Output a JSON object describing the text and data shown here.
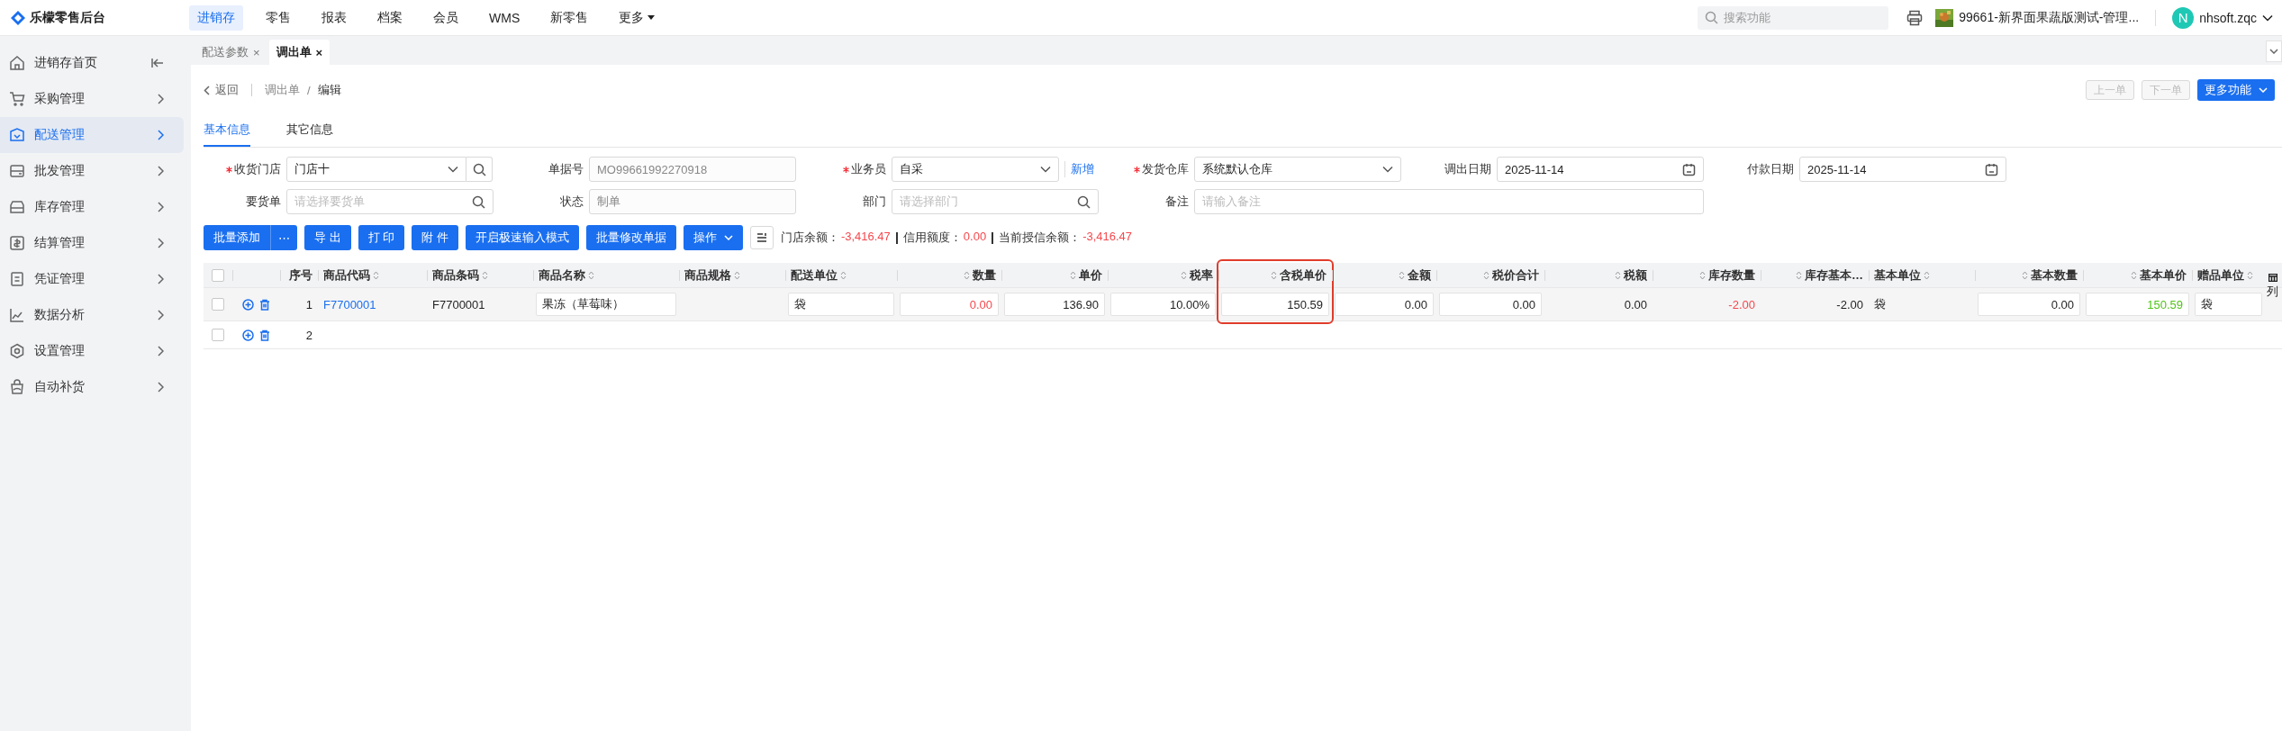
{
  "app": {
    "title": "乐檬零售后台"
  },
  "top_nav": [
    {
      "label": "进销存",
      "selected": true,
      "kind": "link"
    },
    {
      "label": "零售",
      "selected": false,
      "kind": "link"
    },
    {
      "label": "报表",
      "selected": false,
      "kind": "link"
    },
    {
      "label": "档案",
      "selected": false,
      "kind": "link"
    },
    {
      "label": "会员",
      "selected": false,
      "kind": "link"
    },
    {
      "label": "WMS",
      "selected": false,
      "kind": "link"
    },
    {
      "label": "新零售",
      "selected": false,
      "kind": "link"
    },
    {
      "label": "更多",
      "selected": false,
      "kind": "dropdown"
    }
  ],
  "search": {
    "placeholder": "搜索功能"
  },
  "store": {
    "name": "99661-新界面果蔬版测试-管理..."
  },
  "user": {
    "avatar": "N",
    "name": "nhsoft.zqc"
  },
  "sidebar": {
    "items": [
      {
        "label": "进销存首页",
        "selected": false
      },
      {
        "label": "采购管理",
        "selected": false
      },
      {
        "label": "配送管理",
        "selected": true
      },
      {
        "label": "批发管理",
        "selected": false
      },
      {
        "label": "库存管理",
        "selected": false
      },
      {
        "label": "结算管理",
        "selected": false
      },
      {
        "label": "凭证管理",
        "selected": false
      },
      {
        "label": "数据分析",
        "selected": false
      },
      {
        "label": "设置管理",
        "selected": false
      },
      {
        "label": "自动补货",
        "selected": false
      }
    ]
  },
  "tabs": [
    {
      "label": "配送参数",
      "close": "×",
      "selected": false
    },
    {
      "label": "调出单",
      "close": "×",
      "selected": true
    }
  ],
  "breadcrumb": {
    "back": "返回",
    "path": [
      "调出单",
      "编辑"
    ],
    "separator": "/"
  },
  "nav_buttons": [
    {
      "label": "上一单",
      "disabled": true
    },
    {
      "label": "下一单",
      "disabled": true
    }
  ],
  "more_button": {
    "label": "更多功能"
  },
  "section_tabs": [
    {
      "label": "基本信息",
      "selected": true
    },
    {
      "label": "其它信息",
      "selected": false
    }
  ],
  "form": {
    "fields": [
      {
        "label": "收货门店",
        "required": true,
        "disabled": false,
        "kind": "select-search",
        "value": "门店十"
      },
      {
        "label": "单据号",
        "required": false,
        "disabled": true,
        "kind": "text",
        "value": "MO99661992270918"
      },
      {
        "label": "业务员",
        "required": true,
        "disabled": false,
        "kind": "select",
        "value": "自采",
        "link": "新增"
      },
      {
        "label": "发货仓库",
        "required": true,
        "disabled": false,
        "kind": "select",
        "value": "系统默认仓库"
      },
      {
        "label": "调出日期",
        "required": false,
        "disabled": false,
        "kind": "date",
        "value": "2025-11-14"
      },
      {
        "label": "付款日期",
        "required": false,
        "disabled": false,
        "kind": "date",
        "value": "2025-11-14"
      },
      {
        "label": "要货单",
        "required": false,
        "disabled": false,
        "kind": "search",
        "placeholder": "请选择要货单"
      },
      {
        "label": "状态",
        "required": false,
        "disabled": true,
        "kind": "text",
        "value": "制单"
      },
      {
        "label": "部门",
        "required": false,
        "disabled": false,
        "kind": "search",
        "placeholder": "请选择部门"
      },
      {
        "label": "备注",
        "required": false,
        "disabled": false,
        "kind": "wide",
        "placeholder": "请输入备注"
      }
    ]
  },
  "actions": [
    {
      "label": "批量添加",
      "kind": "split",
      "more": "⋯"
    },
    {
      "label": "导 出",
      "kind": "plain"
    },
    {
      "label": "打 印",
      "kind": "plain"
    },
    {
      "label": "附 件",
      "kind": "plain"
    },
    {
      "label": "开启极速输入模式",
      "kind": "plain"
    },
    {
      "label": "批量修改单据",
      "kind": "plain"
    },
    {
      "label": "操作",
      "kind": "dropdown"
    }
  ],
  "balances": [
    {
      "label": "门店余额：",
      "value": "-3,416.47"
    },
    {
      "label": "信用额度：",
      "value": "0.00"
    },
    {
      "label": "当前授信余额：",
      "value": "-3,416.47"
    }
  ],
  "table": {
    "all_checked": false,
    "columns": [
      {
        "label": "序号",
        "sortable": false,
        "kind": "number",
        "highlighted": false
      },
      {
        "label": "商品代码",
        "sortable": true,
        "kind": "text",
        "highlighted": false
      },
      {
        "label": "商品条码",
        "sortable": true,
        "kind": "text",
        "highlighted": false
      },
      {
        "label": "商品名称",
        "sortable": true,
        "kind": "text",
        "highlighted": false
      },
      {
        "label": "商品规格",
        "sortable": true,
        "kind": "text",
        "highlighted": false
      },
      {
        "label": "配送单位",
        "sortable": true,
        "kind": "text",
        "highlighted": false
      },
      {
        "label": "数量",
        "sortable": true,
        "kind": "number",
        "highlighted": false
      },
      {
        "label": "单价",
        "sortable": true,
        "kind": "number",
        "highlighted": false
      },
      {
        "label": "税率",
        "sortable": true,
        "kind": "number",
        "highlighted": false
      },
      {
        "label": "含税单价",
        "sortable": true,
        "kind": "number",
        "highlighted": true
      },
      {
        "label": "金额",
        "sortable": true,
        "kind": "number",
        "highlighted": false
      },
      {
        "label": "税价合计",
        "sortable": true,
        "kind": "number",
        "highlighted": false
      },
      {
        "label": "税额",
        "sortable": true,
        "kind": "number",
        "highlighted": false
      },
      {
        "label": "库存数量",
        "sortable": true,
        "kind": "number",
        "highlighted": false
      },
      {
        "label": "库存基本…",
        "sortable": true,
        "kind": "number",
        "highlighted": false
      },
      {
        "label": "基本单位",
        "sortable": true,
        "kind": "text",
        "highlighted": false
      },
      {
        "label": "基本数量",
        "sortable": true,
        "kind": "number",
        "highlighted": false
      },
      {
        "label": "基本单价",
        "sortable": true,
        "kind": "number",
        "highlighted": false
      },
      {
        "label": "赠品单位",
        "sortable": true,
        "kind": "text",
        "highlighted": false
      }
    ],
    "rows": [
      {
        "checked": false,
        "cells": [
          {
            "kind": "text",
            "text": "1"
          },
          {
            "kind": "link",
            "text": "F7700001"
          },
          {
            "kind": "text",
            "text": "F7700001"
          },
          {
            "kind": "input",
            "text": "果冻（草莓味）"
          },
          {
            "kind": "blank"
          },
          {
            "kind": "input",
            "text": "袋"
          },
          {
            "kind": "input",
            "text": "0.00",
            "color": "#f5484d"
          },
          {
            "kind": "input",
            "text": "136.90"
          },
          {
            "kind": "input",
            "text": "10.00%"
          },
          {
            "kind": "input",
            "text": "150.59"
          },
          {
            "kind": "input",
            "text": "0.00"
          },
          {
            "kind": "input",
            "text": "0.00"
          },
          {
            "kind": "text",
            "text": "0.00"
          },
          {
            "kind": "text",
            "text": "-2.00",
            "color": "#f5484d"
          },
          {
            "kind": "text",
            "text": "-2.00"
          },
          {
            "kind": "text",
            "text": "袋"
          },
          {
            "kind": "input",
            "text": "0.00"
          },
          {
            "kind": "input",
            "text": "150.59",
            "color": "#52c41a"
          },
          {
            "kind": "input",
            "text": "袋"
          }
        ]
      },
      {
        "checked": false,
        "cells": [
          {
            "kind": "text",
            "text": "2"
          }
        ]
      }
    ],
    "column_settings": {
      "label": "列"
    }
  }
}
